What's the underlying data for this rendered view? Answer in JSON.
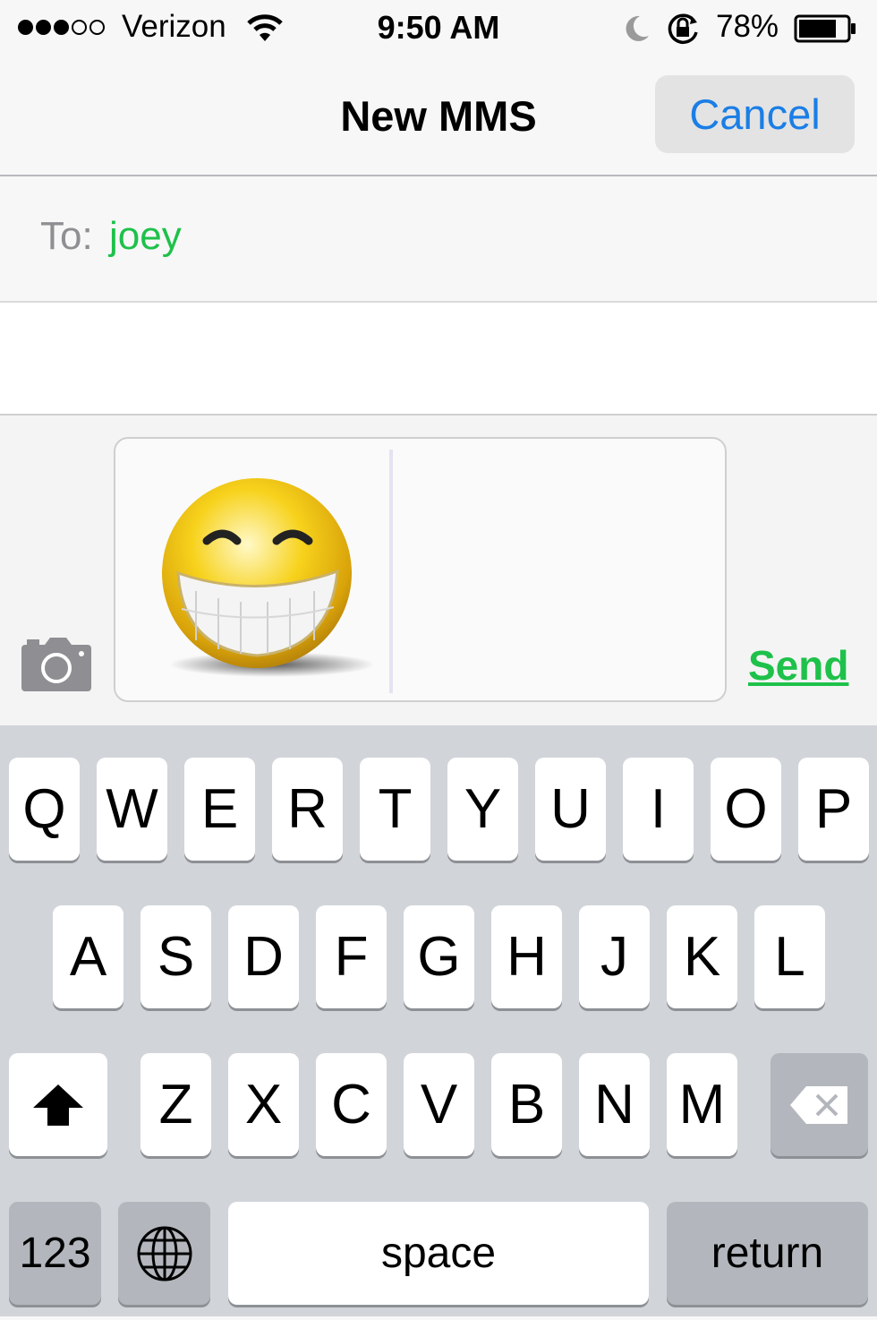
{
  "status": {
    "carrier": "Verizon",
    "time": "9:50 AM",
    "battery": "78%",
    "signal_bars": 3,
    "signal_total": 5
  },
  "nav": {
    "title": "New MMS",
    "cancel": "Cancel"
  },
  "recipient": {
    "label": "To:",
    "name": "joey"
  },
  "compose": {
    "send": "Send",
    "attachment": "smiley-face-image"
  },
  "keyboard": {
    "row1": [
      "Q",
      "W",
      "E",
      "R",
      "T",
      "Y",
      "U",
      "I",
      "O",
      "P"
    ],
    "row2": [
      "A",
      "S",
      "D",
      "F",
      "G",
      "H",
      "J",
      "K",
      "L"
    ],
    "row3": [
      "Z",
      "X",
      "C",
      "V",
      "B",
      "N",
      "M"
    ],
    "num": "123",
    "space": "space",
    "return": "return"
  },
  "colors": {
    "accent_blue": "#1a7ee6",
    "accent_green": "#1ec14a"
  }
}
